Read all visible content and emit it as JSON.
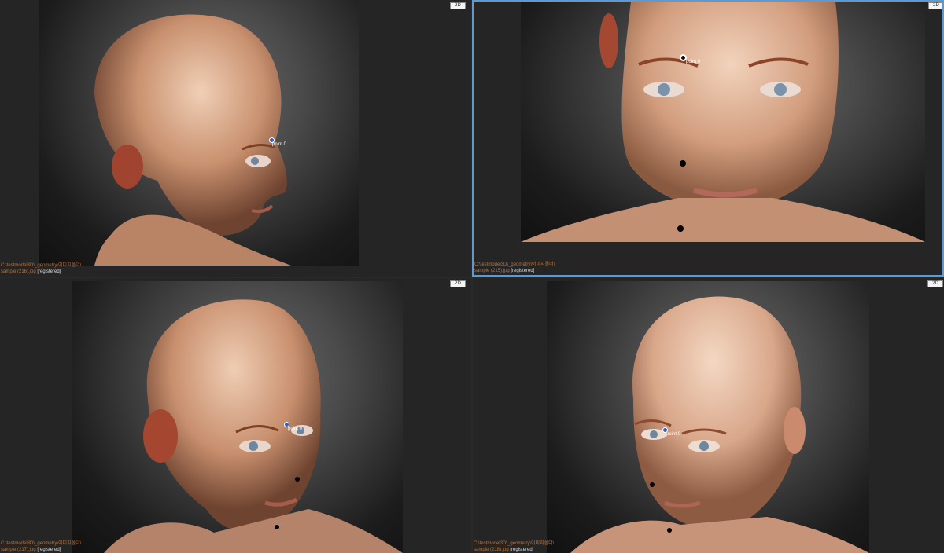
{
  "viewports": [
    {
      "mode": "2D",
      "path": "C:\\testmodel3D\\_geometry\\이미지폴더\\",
      "file": "sample (216).jpg",
      "status": "[registered]",
      "point_label": "point 0"
    },
    {
      "mode": "2D",
      "path": "C:\\testmodel3D\\_geometry\\이미지폴더\\",
      "file": "sample (215).jpg",
      "status": "[registered]",
      "point_label": "point 0"
    },
    {
      "mode": "2D",
      "path": "C:\\testmodel3D\\_geometry\\이미지폴더\\",
      "file": "sample (217).jpg",
      "status": "[registered]",
      "point_label": "point 0"
    },
    {
      "mode": "2D",
      "path": "C:\\testmodel3D\\_geometry\\이미지폴더\\",
      "file": "sample (218).jpg",
      "status": "[registered]",
      "point_label": "point 0"
    }
  ],
  "colors": {
    "active_border": "#5b9bd5",
    "path_text": "#b8733d",
    "skin": "#d9a98a",
    "background": "#252525"
  }
}
